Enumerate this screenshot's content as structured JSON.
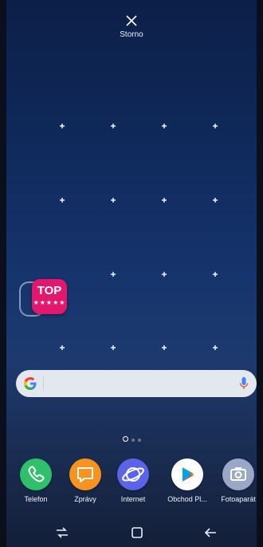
{
  "header": {
    "cancel_label": "Storno"
  },
  "widget": {
    "top_app_label": "TOP",
    "top_app_stars": "★★★★★"
  },
  "dock": {
    "items": [
      {
        "label": "Telefon",
        "icon": "phone-icon",
        "color": "#2fc06a"
      },
      {
        "label": "Zprávy",
        "icon": "messages-icon",
        "color": "#f7931e"
      },
      {
        "label": "Internet",
        "icon": "internet-icon",
        "color": "#5b63e8"
      },
      {
        "label": "Obchod Pl...",
        "icon": "play-store-icon",
        "color": "#ffffff"
      },
      {
        "label": "Fotoaparát",
        "icon": "camera-icon",
        "color": "#9aa7c7"
      }
    ]
  },
  "pager": {
    "pages": 3,
    "current": 1
  },
  "navbar": {
    "buttons": [
      "recents-icon",
      "home-icon",
      "back-icon"
    ]
  }
}
